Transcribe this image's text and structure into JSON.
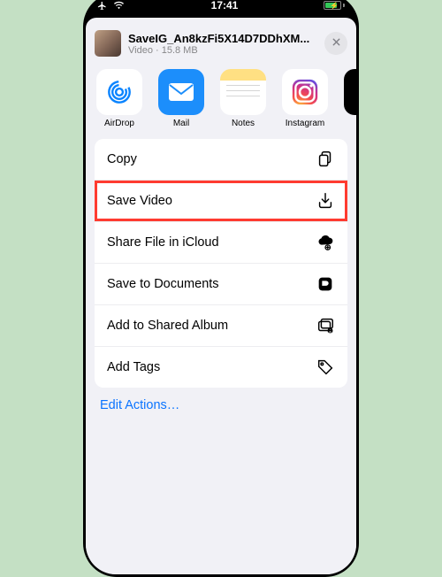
{
  "statusbar": {
    "time": "17:41"
  },
  "header": {
    "file_name": "SaveIG_An8kzFi5X14D7DDhXM...",
    "file_type": "Video",
    "file_size": "15.8 MB",
    "sep": " · "
  },
  "apps": {
    "airdrop": "AirDrop",
    "mail": "Mail",
    "notes": "Notes",
    "instagram": "Instagram"
  },
  "actions": {
    "copy": "Copy",
    "save_video": "Save Video",
    "share_icloud": "Share File in iCloud",
    "save_documents": "Save to Documents",
    "add_shared_album": "Add to Shared Album",
    "add_tags": "Add Tags"
  },
  "edit": "Edit Actions…",
  "highlighted_action": "save_video"
}
